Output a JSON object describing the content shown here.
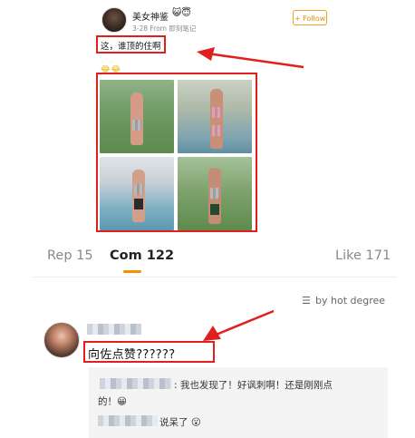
{
  "post": {
    "author": "美女神鉴",
    "author_badge": "😺😇",
    "meta": "3-28  From 即刻笔记",
    "follow_label": "+ Follow",
    "text": "这，谁顶的住啊",
    "emojis": "😂😂"
  },
  "tabs": {
    "reposts": "Rep 15",
    "comments": "Com 122",
    "likes": "Like 171"
  },
  "sort": {
    "icon": "☰",
    "label": "by hot degree"
  },
  "comment": {
    "text": "向佐点赞??????",
    "replies": [
      {
        "text_line1": ": 我也发现了！好讽刺啊！还是刚刚点",
        "text_line2": "的！😀"
      },
      {
        "text": "说呆了 😮"
      }
    ]
  },
  "colors": {
    "accent": "#f29100",
    "highlight": "#e0201c"
  }
}
